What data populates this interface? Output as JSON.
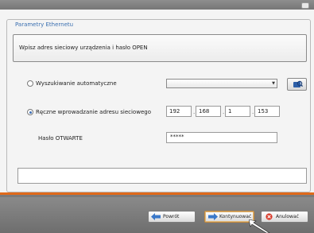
{
  "window": {
    "group_title": "Parametry Ethernetu",
    "instruction": "Wpisz adres sieciowy urządzenia i hasło OPEN"
  },
  "auto_search": {
    "label": "Wyszukiwanie automatyczne",
    "selected": false,
    "dropdown_value": ""
  },
  "manual": {
    "label": "Ręczne wprowadzanie adresu sieciowego",
    "selected": true,
    "ip": [
      "192",
      "168",
      "1",
      "153"
    ],
    "ip_separator": "."
  },
  "password": {
    "label": "Hasło OTWARTE",
    "value": "*****"
  },
  "status": {
    "text": ""
  },
  "buttons": {
    "back": "Powrót",
    "next": "Kontynuować",
    "cancel": "Anulować"
  },
  "icons": {
    "search": "search-device-icon",
    "back": "arrow-left-icon",
    "next": "arrow-right-icon",
    "cancel": "cancel-x-icon"
  },
  "colors": {
    "accent": "#e06a1b",
    "legend": "#3a6fb0",
    "radio_selected": "#3d6fb6",
    "cancel": "#d83a2a"
  }
}
